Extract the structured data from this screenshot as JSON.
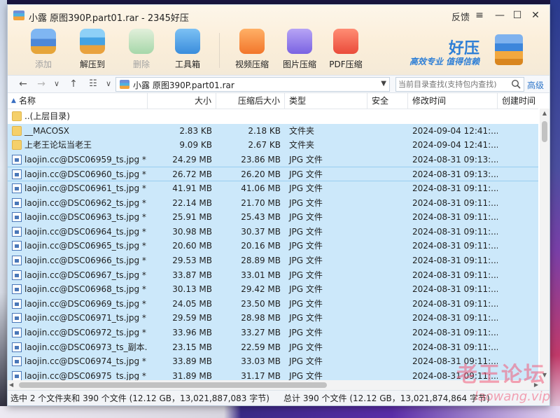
{
  "window": {
    "title": "小露 原图390P.part01.rar - 2345好压",
    "feedback": "反馈",
    "menu_icon": "hamburger-icon",
    "minimize_icon": "minimize-icon",
    "maximize_icon": "maximize-icon",
    "close_icon": "close-icon"
  },
  "toolbar": {
    "add": "添加",
    "extract": "解压到",
    "delete": "删除",
    "tools": "工具箱",
    "video": "视频压缩",
    "image": "图片压缩",
    "pdf": "PDF压缩"
  },
  "brand": {
    "name": "好压",
    "slogan": "高效专业 值得信赖"
  },
  "nav": {
    "path": "小露 原图390P.part01.rar",
    "search_placeholder": "当前目录查找(支持包内查找)",
    "advanced": "高级"
  },
  "columns": {
    "name": "名称",
    "size": "大小",
    "compressed": "压缩后大小",
    "type": "类型",
    "security": "安全",
    "modified": "修改时间",
    "created": "创建时间"
  },
  "rows": [
    {
      "name": "..(上层目录)",
      "size": "",
      "csize": "",
      "type": "",
      "mtime": "",
      "kind": "folder",
      "state": ""
    },
    {
      "name": "__MACOSX",
      "size": "2.83 KB",
      "csize": "2.18 KB",
      "type": "文件夹",
      "mtime": "2024-09-04 12:41:...",
      "kind": "folder",
      "state": "sel"
    },
    {
      "name": "上老王论坛当老王",
      "size": "9.09 KB",
      "csize": "2.67 KB",
      "type": "文件夹",
      "mtime": "2024-09-04 12:41:...",
      "kind": "folder",
      "state": "sel"
    },
    {
      "name": "laojin.cc@DSC06959_ts.jpg *",
      "size": "24.29 MB",
      "csize": "23.86 MB",
      "type": "JPG 文件",
      "mtime": "2024-08-31 09:13:...",
      "kind": "file",
      "state": "sel"
    },
    {
      "name": "laojin.cc@DSC06960_ts.jpg *",
      "size": "26.72 MB",
      "csize": "26.20 MB",
      "type": "JPG 文件",
      "mtime": "2024-08-31 09:13:...",
      "kind": "file",
      "state": "sel2"
    },
    {
      "name": "laojin.cc@DSC06961_ts.jpg *",
      "size": "41.91 MB",
      "csize": "41.06 MB",
      "type": "JPG 文件",
      "mtime": "2024-08-31 09:11:...",
      "kind": "file",
      "state": "sel"
    },
    {
      "name": "laojin.cc@DSC06962_ts.jpg *",
      "size": "22.14 MB",
      "csize": "21.70 MB",
      "type": "JPG 文件",
      "mtime": "2024-08-31 09:11:...",
      "kind": "file",
      "state": "sel"
    },
    {
      "name": "laojin.cc@DSC06963_ts.jpg *",
      "size": "25.91 MB",
      "csize": "25.43 MB",
      "type": "JPG 文件",
      "mtime": "2024-08-31 09:11:...",
      "kind": "file",
      "state": "sel"
    },
    {
      "name": "laojin.cc@DSC06964_ts.jpg *",
      "size": "30.98 MB",
      "csize": "30.37 MB",
      "type": "JPG 文件",
      "mtime": "2024-08-31 09:11:...",
      "kind": "file",
      "state": "sel"
    },
    {
      "name": "laojin.cc@DSC06965_ts.jpg *",
      "size": "20.60 MB",
      "csize": "20.16 MB",
      "type": "JPG 文件",
      "mtime": "2024-08-31 09:11:...",
      "kind": "file",
      "state": "sel"
    },
    {
      "name": "laojin.cc@DSC06966_ts.jpg *",
      "size": "29.53 MB",
      "csize": "28.89 MB",
      "type": "JPG 文件",
      "mtime": "2024-08-31 09:11:...",
      "kind": "file",
      "state": "sel"
    },
    {
      "name": "laojin.cc@DSC06967_ts.jpg *",
      "size": "33.87 MB",
      "csize": "33.01 MB",
      "type": "JPG 文件",
      "mtime": "2024-08-31 09:11:...",
      "kind": "file",
      "state": "sel"
    },
    {
      "name": "laojin.cc@DSC06968_ts.jpg *",
      "size": "30.13 MB",
      "csize": "29.42 MB",
      "type": "JPG 文件",
      "mtime": "2024-08-31 09:11:...",
      "kind": "file",
      "state": "sel"
    },
    {
      "name": "laojin.cc@DSC06969_ts.jpg *",
      "size": "24.05 MB",
      "csize": "23.50 MB",
      "type": "JPG 文件",
      "mtime": "2024-08-31 09:11:...",
      "kind": "file",
      "state": "sel"
    },
    {
      "name": "laojin.cc@DSC06971_ts.jpg *",
      "size": "29.59 MB",
      "csize": "28.98 MB",
      "type": "JPG 文件",
      "mtime": "2024-08-31 09:11:...",
      "kind": "file",
      "state": "sel"
    },
    {
      "name": "laojin.cc@DSC06972_ts.jpg *",
      "size": "33.96 MB",
      "csize": "33.27 MB",
      "type": "JPG 文件",
      "mtime": "2024-08-31 09:11:...",
      "kind": "file",
      "state": "sel"
    },
    {
      "name": "laojin.cc@DSC06973_ts_副本....",
      "size": "23.15 MB",
      "csize": "22.59 MB",
      "type": "JPG 文件",
      "mtime": "2024-08-31 09:11:...",
      "kind": "file",
      "state": "sel"
    },
    {
      "name": "laojin.cc@DSC06974_ts.jpg *",
      "size": "33.89 MB",
      "csize": "33.03 MB",
      "type": "JPG 文件",
      "mtime": "2024-08-31 09:11:...",
      "kind": "file",
      "state": "sel"
    },
    {
      "name": "laojin.cc@DSC06975_ts.jpg *",
      "size": "31.89 MB",
      "csize": "31.17 MB",
      "type": "JPG 文件",
      "mtime": "2024-08-31 09:11:...",
      "kind": "file",
      "state": "sel"
    }
  ],
  "status": {
    "left": "选中 2 个文件夹和 390 个文件 (12.12 GB，13,021,887,083 字节)",
    "right": "总计 390 个文件 (12.12 GB，13,021,874,864 字节)"
  },
  "watermark": {
    "text": "老王论坛",
    "sub": "laowang.vip"
  },
  "colors": {
    "selected_row": "#cce8fa",
    "accent": "#2e7fd6",
    "header_bg": "#fbeed9"
  }
}
